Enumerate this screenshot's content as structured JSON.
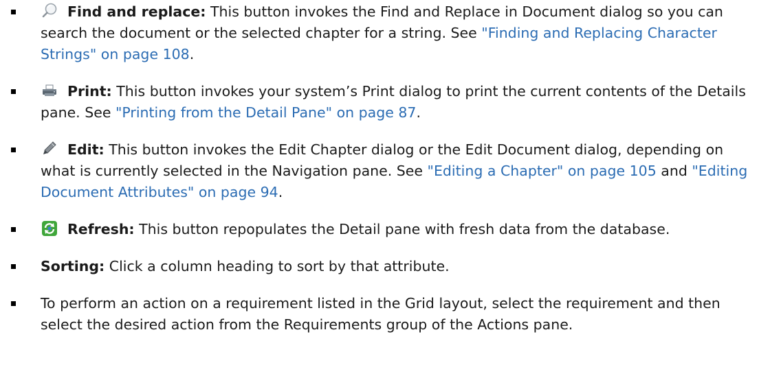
{
  "items": [
    {
      "icon": "magnifier-icon",
      "title": "Find and replace:",
      "text1": " This button invokes the Find and Replace in Document dialog so you can search the document or the selected chapter for a string. See ",
      "link1": "\"Finding and Replacing Character Strings\" on page 108",
      "text2": "."
    },
    {
      "icon": "printer-icon",
      "title": "Print:",
      "text1": " This button invokes your system’s Print dialog to print the current contents of the Details pane. See ",
      "link1": "\"Printing from the Detail Pane\" on page 87",
      "text2": "."
    },
    {
      "icon": "pen-icon",
      "title": "Edit:",
      "text1": " This button invokes the Edit Chapter dialog or the Edit Document dialog, depending on what is currently selected in the Navigation pane. See ",
      "link1": "\"Editing a Chapter\" on page 105",
      "text2": " and ",
      "link2": "\"Editing Document Attributes\" on page 94",
      "text3": "."
    },
    {
      "icon": "refresh-icon",
      "title": "Refresh:",
      "text1": " This button repopulates the Detail pane with fresh data from the database."
    },
    {
      "title": "Sorting:",
      "text1": " Click a column heading to sort by that attribute."
    },
    {
      "text1": "To perform an action on a requirement listed in the Grid layout, select the requirement and then select the desired action from the Requirements group of the Actions pane."
    }
  ],
  "colors": {
    "link": "#2b6cb3",
    "text": "#1a1a1a",
    "refresh_green": "#3fa63a",
    "refresh_blue": "#3b82c4"
  }
}
